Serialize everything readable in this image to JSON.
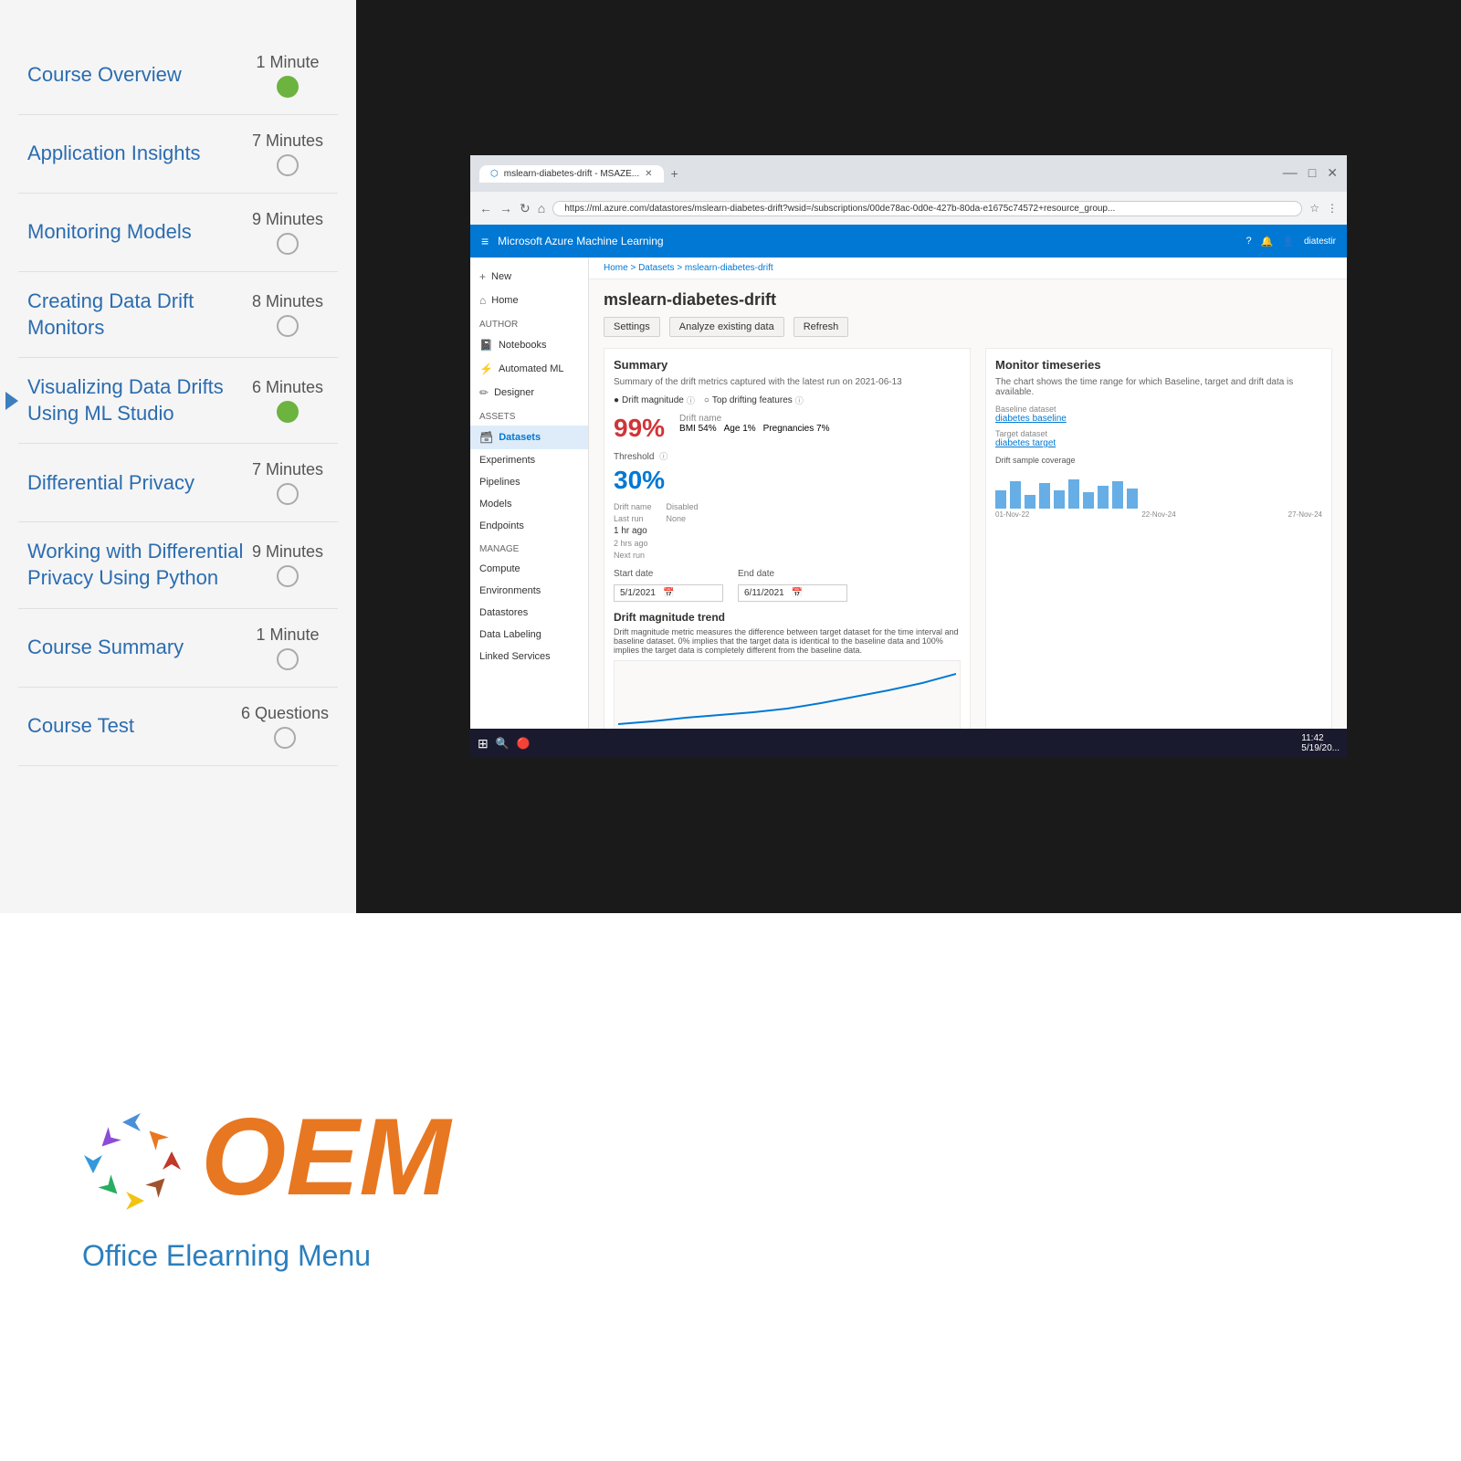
{
  "top_section": {
    "course_list": {
      "items": [
        {
          "name": "Course Overview",
          "duration": "1 Minute",
          "status": "complete",
          "active": false
        },
        {
          "name": "Application Insights",
          "duration": "7 Minutes",
          "status": "empty",
          "active": false
        },
        {
          "name": "Monitoring Models",
          "duration": "9 Minutes",
          "status": "empty",
          "active": false
        },
        {
          "name": "Creating Data Drift Monitors",
          "duration": "8 Minutes",
          "status": "empty",
          "active": false
        },
        {
          "name": "Visualizing Data Drifts Using ML Studio",
          "duration": "6 Minutes",
          "status": "complete",
          "active": true
        },
        {
          "name": "Differential Privacy",
          "duration": "7 Minutes",
          "status": "empty",
          "active": false
        },
        {
          "name": "Working with Differential Privacy Using Python",
          "duration": "9 Minutes",
          "status": "empty",
          "active": false
        },
        {
          "name": "Course Summary",
          "duration": "1 Minute",
          "status": "empty",
          "active": false
        },
        {
          "name": "Course Test",
          "duration": "6 Questions",
          "status": "empty",
          "active": false
        }
      ]
    },
    "browser": {
      "tab_label": "mslearn-diabetes-drift - MSAZE...",
      "address": "https://ml.azure.com/datastores/mslearn-diabetes-drift?wsid=/subscriptions/00de78ac-0d0e-427b-80da-e1675c74572+resource_group...",
      "azure_header_text": "Microsoft Azure Machine Learning",
      "breadcrumb": "Home > Datasets > mslearn-diabetes-drift",
      "page_title": "mslearn-diabetes-drift",
      "action_buttons": [
        "Settings",
        "Analyze existing data",
        "Refresh"
      ],
      "summary_section": {
        "title": "Summary",
        "subtitle": "Summary of the drift metrics captured with the latest run on 2021-06-13",
        "drift_magnitude_label": "Drift magnitude",
        "top_drifting_label": "Top drifting features",
        "drift_value": "99%",
        "threshold_label": "Threshold",
        "threshold_value": "30%",
        "drift_name_label": "Drift name",
        "last_run_label": "Last run",
        "last_run_value": "1 hr ago",
        "prev_run_label": "2 hrs ago",
        "next_run_label": "Next run",
        "schedule_status": "Disabled",
        "drift_frequency": "None",
        "features": [
          {
            "name": "BMI",
            "pct": "54%"
          },
          {
            "name": "Age",
            "pct": "1%"
          },
          {
            "name": "Pregnancies",
            "pct": "7%"
          }
        ]
      },
      "monitor_timeseries": {
        "title": "Monitor timeseries",
        "subtitle": "The chart shows the time range for which Baseline, target and drift data is available.",
        "baseline_label": "Baseline dataset",
        "baseline_value": "diabetes baseline",
        "target_label": "Target dataset",
        "target_value": "diabetes target",
        "drift_sample_label": "Drift sample coverage",
        "dates": [
          "01-Nov-22",
          "22-Nov-24",
          "27-Nov-24"
        ],
        "bars": [
          20,
          30,
          15,
          28,
          20,
          32,
          18,
          25,
          30,
          22
        ]
      },
      "date_range": {
        "start_label": "Start date",
        "start_value": "5/1/2021",
        "end_label": "End date",
        "end_value": "6/11/2021"
      },
      "drift_trend": {
        "title": "Drift magnitude trend",
        "description": "Drift magnitude metric measures the difference between target dataset for the time interval and baseline dataset. 0% implies that the target data is identical to the baseline data and 100% implies the target data is completely different from the baseline data."
      }
    }
  },
  "bottom_section": {
    "logo_text": "OEM",
    "tagline": "Office Elearning Menu",
    "logo_alt": "OEM Office Elearning Menu Logo"
  },
  "taskbar": {
    "time": "11:42",
    "date": "5/19/20..."
  }
}
